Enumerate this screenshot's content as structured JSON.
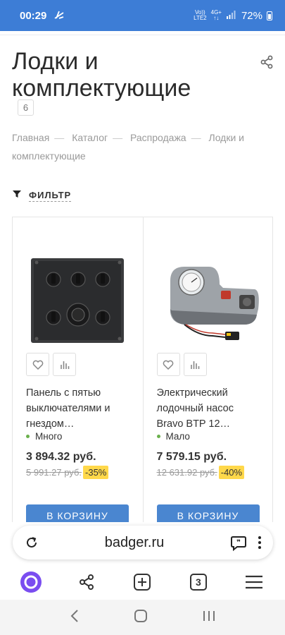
{
  "status_bar": {
    "time": "00:29",
    "network_line1": "Vo))",
    "network_line2": "LTE2",
    "network_type": "4G+",
    "battery": "72%"
  },
  "page": {
    "title": "Лодки и комплектующие",
    "count": "6"
  },
  "breadcrumb": [
    "Главная",
    "Каталог",
    "Распродажа",
    "Лодки и комплектующие"
  ],
  "filter": {
    "label": "ФИЛЬТР"
  },
  "products": [
    {
      "name": "Панель с пятью выключателями и гнездом…",
      "stock": "Много",
      "price": "3 894.32 руб.",
      "old_price": "5 991.27 руб.",
      "discount": "-35%",
      "cart_label": "В КОРЗИНУ"
    },
    {
      "name": "Электрический лодочный насос Bravo BTP 12…",
      "stock": "Мало",
      "price": "7 579.15 руб.",
      "old_price": "12 631.92 руб.",
      "discount": "-40%",
      "cart_label": "В КОРЗИНУ"
    }
  ],
  "browser": {
    "url": "badger.ru",
    "tabs_count": "3"
  },
  "colors": {
    "status_bar": "#3d7dd6",
    "cart_button": "#4a86d0",
    "discount": "#ffd84a",
    "stock_dot": "#6ab04c",
    "alice_button": "#7a4df0"
  }
}
